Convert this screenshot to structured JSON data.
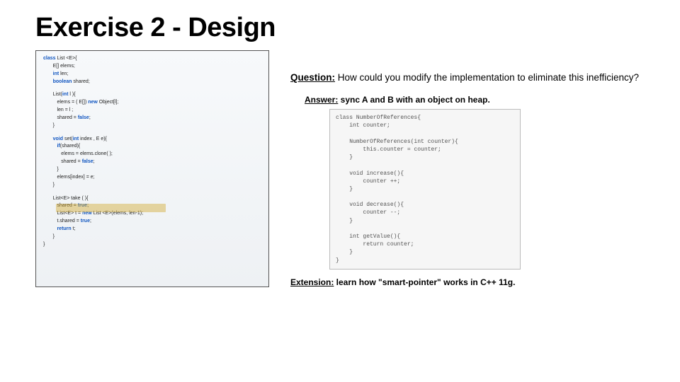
{
  "title": "Exercise 2 - Design",
  "code": {
    "l1a": "class",
    "l1b": " List <E>{",
    "l2a": "E[] ",
    "l2b": "elems",
    "l3a": "int ",
    "l3b": "len",
    "l4a": "boolean ",
    "l4b": "shared",
    "l5a": "List(",
    "l5b": "int ",
    "l5c": "l ){",
    "l6a": "elems ",
    "l6b": "= ( E[]) ",
    "l6c": "new ",
    "l6d": "Object[l];",
    "l7": "len = l ;",
    "l8a": "shared = ",
    "l8b": "false",
    "l9": "}",
    "l10a": "void ",
    "l10b": "set(",
    "l10c": "int ",
    "l10d": "index , E e){",
    "l11a": "if",
    "l11b": "(shared){",
    "l12a": "elems ",
    "l12b": "= ",
    "l12c": "elems.clone( );",
    "l13a": "shared = ",
    "l13b": "false",
    "l14": "}",
    "l15": "elems[index] = e;",
    "l16": "}",
    "l17": "List<E> take ( ){",
    "l18a": "shared = ",
    "l18b": "true",
    "l19a": "List<E> t = ",
    "l19b": "new ",
    "l19c": "List <E>(elems, len-1);",
    "l20a": "t.shared = ",
    "l20b": "true",
    "l21a": "return ",
    "l21b": "t;",
    "l22": "}",
    "l23": "}"
  },
  "question": {
    "label": "Question:",
    "text": " How could you modify the implementation to eliminate this inefficiency?"
  },
  "answer": {
    "label": "Answer:",
    "text": " sync A and B with an object on heap."
  },
  "refcode": "class NumberOfReferences{\n    int counter;\n\n    NumberOfReferences(int counter){\n        this.counter = counter;\n    }\n\n    void increase(){\n        counter ++;\n    }\n\n    void decrease(){\n        counter --;\n    }\n\n    int getValue(){\n        return counter;\n    }\n}",
  "extension": {
    "label": "Extension:",
    "text": " learn how \"smart-pointer\" works in C++ 11g."
  }
}
